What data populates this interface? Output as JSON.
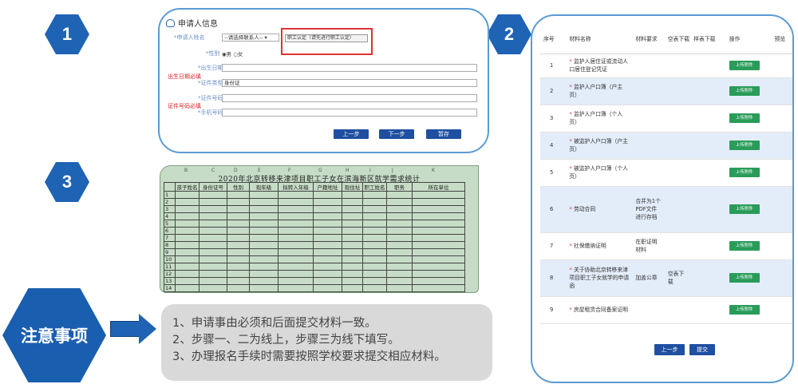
{
  "steps": {
    "s1": "1",
    "s2": "2",
    "s3": "3",
    "notice": "注意事项"
  },
  "panel1": {
    "title": "申请人信息",
    "rows": [
      {
        "label": "*申请人姓名",
        "value": "--请选择联系人-- ▾"
      },
      {
        "label": "*性别",
        "value": "◉男  ○女"
      },
      {
        "label": "*出生日期",
        "value": ""
      },
      {
        "label": "*证件类型",
        "value": "身份证"
      },
      {
        "label": "*证件号码",
        "value": ""
      },
      {
        "label": "*手机号码",
        "value": ""
      }
    ],
    "highlight_button": "职工认定（请先进行职工认定）",
    "note_birth": "出生日期必填",
    "note_id": "证件号码必填",
    "buttons": {
      "prev": "上一步",
      "next": "下一步",
      "save": "暂存"
    }
  },
  "panel3": {
    "col_letters": [
      "B",
      "C",
      "D",
      "E",
      "F",
      "G",
      "H",
      "I",
      "J",
      "K"
    ],
    "title": "2020年北京转移来津项目职工子女在滨海新区就学需求统计",
    "headers": [
      "孩子姓名",
      "身份证号",
      "性别",
      "现年级",
      "拟转入年级",
      "户籍地址",
      "现住址",
      "职工姓名",
      "职务",
      "所在单位"
    ],
    "row_numbers": [
      "1",
      "2",
      "3",
      "4",
      "5",
      "6",
      "7",
      "8",
      "9",
      "10",
      "11",
      "12",
      "13",
      "14"
    ]
  },
  "panel2": {
    "headers": [
      "序号",
      "材料名称",
      "材料要求",
      "空表下载",
      "样表下载",
      "操作",
      "预览"
    ],
    "upload_label": "上传附件",
    "rows": [
      {
        "no": "1",
        "name": "监护人居住证或流动人口居住登记凭证",
        "req": "",
        "blank": ""
      },
      {
        "no": "2",
        "name": "监护人户口簿（户主页）",
        "req": "",
        "blank": ""
      },
      {
        "no": "3",
        "name": "监护人户口簿（个人页）",
        "req": "",
        "blank": ""
      },
      {
        "no": "4",
        "name": "被监护人户口簿（户主页）",
        "req": "",
        "blank": ""
      },
      {
        "no": "5",
        "name": "被监护人户口簿（个人页）",
        "req": "",
        "blank": ""
      },
      {
        "no": "6",
        "name": "劳动合同",
        "req": "合并为1个PDF文件进行存档",
        "blank": ""
      },
      {
        "no": "7",
        "name": "社保缴纳证明",
        "req": "在职证明材料",
        "blank": ""
      },
      {
        "no": "8",
        "name": "关于协助北京转移来津项目职工子女就学的申请函",
        "req": "加盖公章",
        "blank": "空表下载"
      },
      {
        "no": "9",
        "name": "房屋租赁合同备案证明",
        "req": "",
        "blank": ""
      }
    ],
    "buttons": {
      "prev": "上一步",
      "submit": "提交"
    }
  },
  "notes": {
    "items": [
      "1、申请事由必须和后面提交材料一致。",
      "2、步骤一、二为线上，步骤三为线下填写。",
      "3、办理报名手续时需要按照学校要求提交相应材料。"
    ]
  },
  "colors": {
    "step_blue": "#1f63b4",
    "panel_border": "#5b9bd5",
    "upload_green": "#2a9c5a",
    "row_alt": "#e3ecf9",
    "highlight_red": "#d33333"
  }
}
